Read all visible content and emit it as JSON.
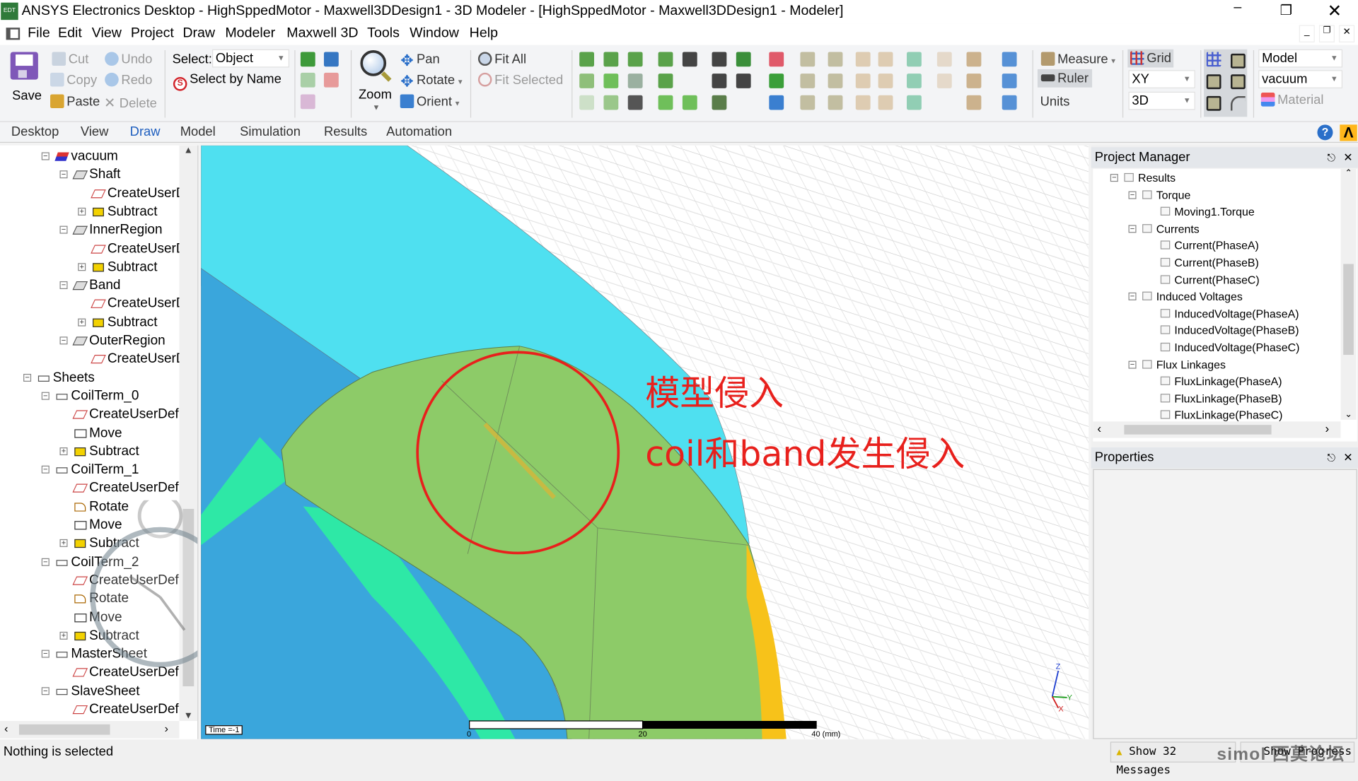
{
  "window": {
    "title": "ANSYS Electronics Desktop - HighSppedMotor - Maxwell3DDesign1 - 3D Modeler - [HighSppedMotor - Maxwell3DDesign1 - Modeler]",
    "app_icon_text": "EDT"
  },
  "menu": [
    "File",
    "Edit",
    "View",
    "Project",
    "Draw",
    "Modeler",
    "Maxwell 3D",
    "Tools",
    "Window",
    "Help"
  ],
  "ribbon": {
    "save": "Save",
    "cut": "Cut",
    "copy": "Copy",
    "paste": "Paste",
    "undo": "Undo",
    "redo": "Redo",
    "delete": "Delete",
    "select_label": "Select:",
    "select_value": "Object",
    "select_by_name": "Select by Name",
    "zoom": "Zoom",
    "pan": "Pan",
    "rotate": "Rotate",
    "orient": "Orient",
    "fit_all": "Fit All",
    "fit_selected": "Fit Selected",
    "measure": "Measure",
    "ruler": "Ruler",
    "units": "Units",
    "grid": "Grid",
    "grid_plane": "XY",
    "grid_mode": "3D",
    "model_select": "Model",
    "material_select": "vacuum",
    "material": "Material",
    "draw_icons": [
      "box-icon",
      "cone-icon",
      "helix-icon",
      "cylinder-icon",
      "sphere-icon",
      "spiral-icon",
      "polyhedron-icon",
      "torus-icon",
      "bondwire-icon",
      "rectangle-icon",
      "ellipse-icon",
      "circle-icon",
      "equation-surface-icon",
      "regular-polygon-icon",
      "line-icon",
      "arc-icon",
      "spline-icon",
      "equation-curve-icon",
      "center-arc-icon",
      "region-icon",
      "point-icon",
      "plane-icon"
    ]
  },
  "tabs": [
    {
      "label": "Desktop"
    },
    {
      "label": "View"
    },
    {
      "label": "Draw",
      "active": true
    },
    {
      "label": "Model"
    },
    {
      "label": "Simulation"
    },
    {
      "label": "Results"
    },
    {
      "label": "Automation"
    }
  ],
  "model_tree": [
    {
      "label": "vacuum",
      "level": 2,
      "exp": "-",
      "icon": "material"
    },
    {
      "label": "Shaft",
      "level": 3,
      "exp": "-",
      "icon": "solid"
    },
    {
      "label": "CreateUserDefinedPart",
      "level": 4,
      "exp": "",
      "icon": "op"
    },
    {
      "label": "Subtract",
      "level": 4,
      "exp": "+",
      "icon": "subtract"
    },
    {
      "label": "InnerRegion",
      "level": 3,
      "exp": "-",
      "icon": "solid"
    },
    {
      "label": "CreateUserDefinedPart",
      "level": 4,
      "exp": "",
      "icon": "op"
    },
    {
      "label": "Subtract",
      "level": 4,
      "exp": "+",
      "icon": "subtract"
    },
    {
      "label": "Band",
      "level": 3,
      "exp": "-",
      "icon": "solid"
    },
    {
      "label": "CreateUserDefinedPart",
      "level": 4,
      "exp": "",
      "icon": "op"
    },
    {
      "label": "Subtract",
      "level": 4,
      "exp": "+",
      "icon": "subtract"
    },
    {
      "label": "OuterRegion",
      "level": 3,
      "exp": "-",
      "icon": "solid"
    },
    {
      "label": "CreateUserDefinedPart",
      "level": 4,
      "exp": "",
      "icon": "op"
    },
    {
      "label": "Sheets",
      "level": 1,
      "exp": "-",
      "icon": "sheet"
    },
    {
      "label": "CoilTerm_0",
      "level": 2,
      "exp": "-",
      "icon": "sheet"
    },
    {
      "label": "CreateUserDef",
      "level": 3,
      "exp": "",
      "icon": "op"
    },
    {
      "label": "Move",
      "level": 3,
      "exp": "",
      "icon": "move"
    },
    {
      "label": "Subtract",
      "level": 3,
      "exp": "+",
      "icon": "subtract"
    },
    {
      "label": "CoilTerm_1",
      "level": 2,
      "exp": "-",
      "icon": "sheet"
    },
    {
      "label": "CreateUserDef",
      "level": 3,
      "exp": "",
      "icon": "op"
    },
    {
      "label": "Rotate",
      "level": 3,
      "exp": "",
      "icon": "rotate"
    },
    {
      "label": "Move",
      "level": 3,
      "exp": "",
      "icon": "move"
    },
    {
      "label": "Subtract",
      "level": 3,
      "exp": "+",
      "icon": "subtract"
    },
    {
      "label": "CoilTerm_2",
      "level": 2,
      "exp": "-",
      "icon": "sheet"
    },
    {
      "label": "CreateUserDef",
      "level": 3,
      "exp": "",
      "icon": "op"
    },
    {
      "label": "Rotate",
      "level": 3,
      "exp": "",
      "icon": "rotate"
    },
    {
      "label": "Move",
      "level": 3,
      "exp": "",
      "icon": "move"
    },
    {
      "label": "Subtract",
      "level": 3,
      "exp": "+",
      "icon": "subtract"
    },
    {
      "label": "MasterSheet",
      "level": 2,
      "exp": "-",
      "icon": "sheet"
    },
    {
      "label": "CreateUserDef",
      "level": 3,
      "exp": "",
      "icon": "op"
    },
    {
      "label": "SlaveSheet",
      "level": 2,
      "exp": "-",
      "icon": "sheet"
    },
    {
      "label": "CreateUserDef",
      "level": 3,
      "exp": "",
      "icon": "op"
    }
  ],
  "viewport": {
    "annotation_1": "模型侵入",
    "annotation_2": "coil和band发生侵入",
    "annotation_color": "#e8201c",
    "time_label": "Time =-1",
    "scale": {
      "ticks": [
        "0",
        "20",
        "40 (mm)"
      ]
    },
    "axes": {
      "x": "X",
      "y": "Y",
      "z": "Z"
    },
    "colors": {
      "cyan": "#4fe0f0",
      "blue": "#3aa6dc",
      "green": "#8dcb68",
      "yellow": "#f7c21a",
      "mint": "#2ee8a6"
    }
  },
  "project_manager": {
    "title": "Project Manager",
    "rows": [
      {
        "label": "Results",
        "level": 0,
        "exp": "-"
      },
      {
        "label": "Torque",
        "level": 1,
        "exp": "-"
      },
      {
        "label": "Moving1.Torque",
        "level": 2,
        "exp": ""
      },
      {
        "label": "Currents",
        "level": 1,
        "exp": "-"
      },
      {
        "label": "Current(PhaseA)",
        "level": 2,
        "exp": ""
      },
      {
        "label": "Current(PhaseB)",
        "level": 2,
        "exp": ""
      },
      {
        "label": "Current(PhaseC)",
        "level": 2,
        "exp": ""
      },
      {
        "label": "Induced Voltages",
        "level": 1,
        "exp": "-"
      },
      {
        "label": "InducedVoltage(PhaseA)",
        "level": 2,
        "exp": ""
      },
      {
        "label": "InducedVoltage(PhaseB)",
        "level": 2,
        "exp": ""
      },
      {
        "label": "InducedVoltage(PhaseC)",
        "level": 2,
        "exp": ""
      },
      {
        "label": "Flux Linkages",
        "level": 1,
        "exp": "-"
      },
      {
        "label": "FluxLinkage(PhaseA)",
        "level": 2,
        "exp": ""
      },
      {
        "label": "FluxLinkage(PhaseB)",
        "level": 2,
        "exp": ""
      },
      {
        "label": "FluxLinkage(PhaseC)",
        "level": 2,
        "exp": ""
      }
    ]
  },
  "properties": {
    "title": "Properties"
  },
  "status": {
    "text": "Nothing is selected",
    "messages": "Show 32 Messages",
    "progress": "Show Progress",
    "watermark": "simol 西莫论坛"
  }
}
